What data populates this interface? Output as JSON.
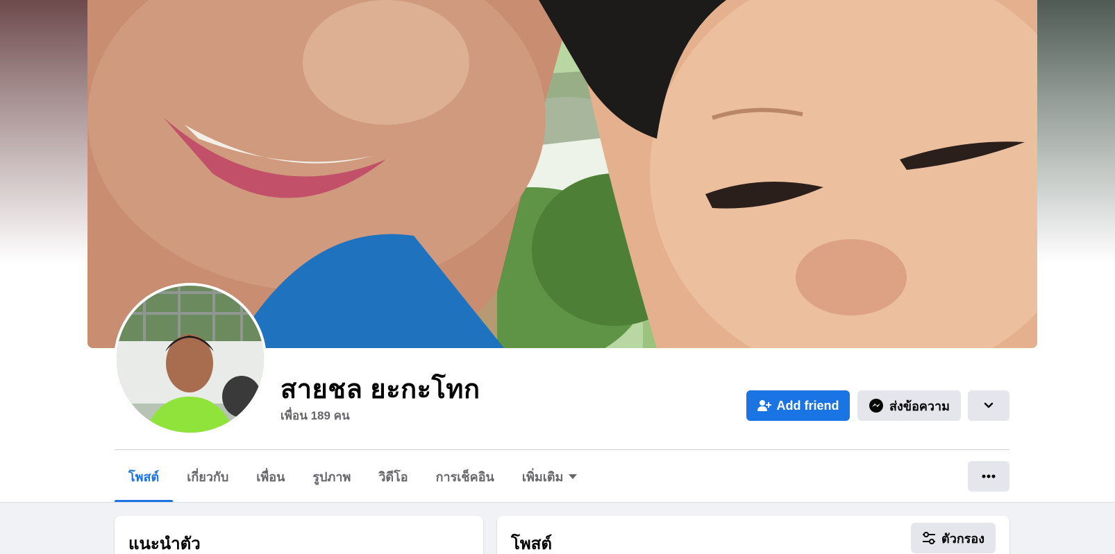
{
  "profile": {
    "name": "สายชล ยะกะโทก",
    "friends_count": "เพื่อน 189 คน"
  },
  "actions": {
    "add_friend_label": "Add friend",
    "message_label": "ส่งข้อความ"
  },
  "tabs": [
    {
      "label": "โพสต์",
      "active": true
    },
    {
      "label": "เกี่ยวกับ",
      "active": false
    },
    {
      "label": "เพื่อน",
      "active": false
    },
    {
      "label": "รูปภาพ",
      "active": false
    },
    {
      "label": "วิดีโอ",
      "active": false
    },
    {
      "label": "การเช็คอิน",
      "active": false
    },
    {
      "label": "เพิ่มเติม",
      "active": false
    }
  ],
  "intro_card": {
    "title": "แนะนำตัว"
  },
  "posts_card": {
    "title": "โพสต์",
    "filter_label": "ตัวกรอง"
  },
  "colors": {
    "accent": "#1b74e4",
    "secondary_button": "#e4e6eb",
    "text_muted": "#65676b"
  },
  "icons": [
    "add-friend-icon",
    "messenger-icon",
    "chevron-down-icon",
    "caret-down-icon",
    "more-dots-icon",
    "filter-sliders-icon"
  ]
}
